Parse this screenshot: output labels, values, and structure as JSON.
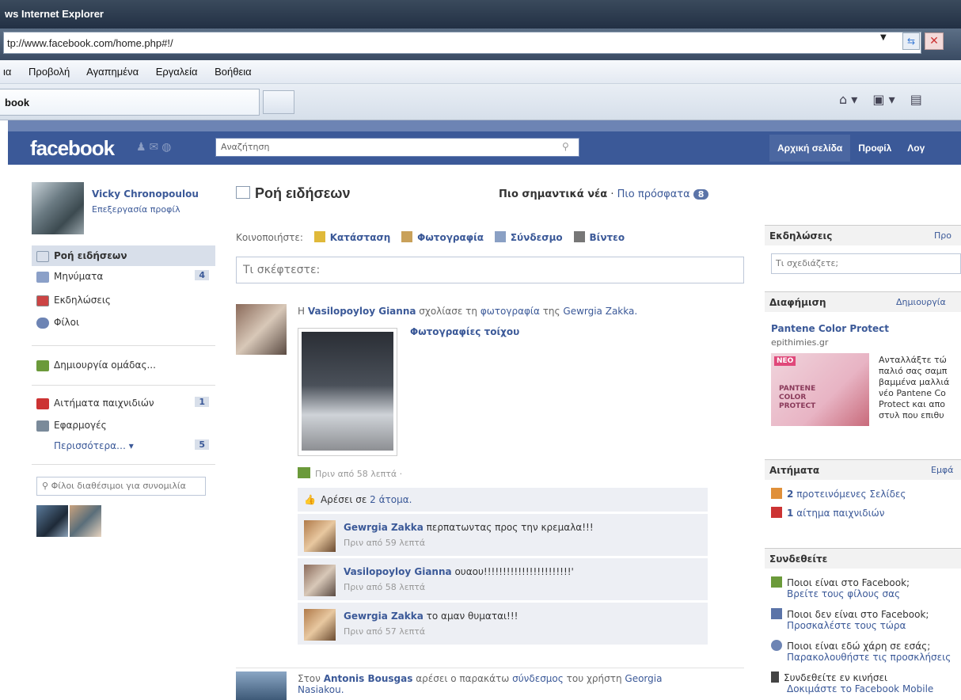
{
  "window": {
    "title": "ws Internet Explorer",
    "url": "tp://www.facebook.com/home.php#!/",
    "tab": "book"
  },
  "menu": [
    "ια",
    "Προβολή",
    "Αγαπημένα",
    "Εργαλεία",
    "Βοήθεια"
  ],
  "fb": {
    "logo": "facebook",
    "search_placeholder": "Αναζήτηση",
    "topnav": [
      "Αρχική σελίδα",
      "Προφίλ",
      "Λογ"
    ]
  },
  "profile": {
    "name": "Vicky Chronopoulou",
    "edit": "Επεξεργασία προφίλ"
  },
  "left_nav": [
    {
      "label": "Ροή ειδήσεων",
      "count": ""
    },
    {
      "label": "Μηνύματα",
      "count": "4"
    },
    {
      "label": "Εκδηλώσεις",
      "count": ""
    },
    {
      "label": "Φίλοι",
      "count": ""
    },
    {
      "label": "Δημιουργία ομάδας...",
      "count": ""
    },
    {
      "label": "Αιτήματα παιχνιδιών",
      "count": "1"
    },
    {
      "label": "Εφαρμογές",
      "count": ""
    },
    {
      "label": "Περισσότερα… ▾",
      "count": "5"
    }
  ],
  "chat_placeholder": "Φίλοι διαθέσιμοι για συνομιλία",
  "feed": {
    "title": "Ροή ειδήσεων",
    "top": "Πιο σημαντικά νέα",
    "recent": "Πιο πρόσφατα",
    "recent_count": "8",
    "share_label": "Κοινοποιήστε:",
    "share_opts": [
      "Κατάσταση",
      "Φωτογραφία",
      "Σύνδεσμο",
      "Βίντεο"
    ],
    "status_placeholder": "Τι σκέφτεστε:"
  },
  "story1": {
    "prefix": "Η",
    "actor": "Vasilopoyloy Gianna",
    "mid": "σχολίασε τη",
    "link": "φωτογραφία",
    "mid2": "της",
    "target": "Gewrgia Zakka.",
    "album": "Φωτογραφίες τοίχου",
    "time": "Πριν από 58 λεπτά ·",
    "likes_pre": "Αρέσει σε",
    "likes_link": "2 άτομα.",
    "comments": [
      {
        "author": "Gewrgia Zakka",
        "text": "περπατωντας προς την κρεμαλα!!!",
        "time": "Πριν από 59 λεπτά"
      },
      {
        "author": "Vasilopoyloy Gianna",
        "text": "ουαου!!!!!!!!!!!!!!!!!!!!!!!'",
        "time": "Πριν από 58 λεπτά"
      },
      {
        "author": "Gewrgia Zakka",
        "text": "το αμαν θυμαται!!!",
        "time": "Πριν από 57 λεπτά"
      }
    ]
  },
  "story2": {
    "prefix": "Στον",
    "actor": "Antonis Bousgas",
    "mid": "αρέσει ο παρακάτω",
    "link": "σύνδεσμος",
    "mid2": "του χρήστη",
    "target": "Georgia",
    "line2": "Nasiakou."
  },
  "right": {
    "events_title": "Εκδηλώσεις",
    "events_link": "Προ",
    "events_placeholder": "Τι σχεδιάζετε;",
    "ad_title": "Διαφήμιση",
    "ad_link": "Δημιουργία",
    "ad_name": "Pantene Color Protect",
    "ad_domain": "epithimies.gr",
    "ad_badge": "ΝΕΟ",
    "ad_img_text": "PANTENE COLOR PROTECT",
    "ad_text": [
      "Ανταλλάξτε τώ",
      "παλιό σας σαμπ",
      "βαμμένα μαλλιά",
      "νέο Pantene Co",
      "Protect και απο",
      "στυλ που επιθυ"
    ],
    "req_title": "Αιτήματα",
    "req_link": "Εμφά",
    "req_items": [
      {
        "num": "2",
        "text": "προτεινόμενες Σελίδες"
      },
      {
        "num": "1",
        "text": "αίτημα παιχνιδιών"
      }
    ],
    "connect_title": "Συνδεθείτε",
    "connect_items": [
      {
        "line": "Ποιοι είναι στο Facebook;",
        "sub": "Βρείτε τους φίλους σας"
      },
      {
        "line": "Ποιοι δεν είναι στο Facebook;",
        "sub": "Προσκαλέστε τους τώρα"
      },
      {
        "line": "Ποιοι είναι εδώ χάρη σε εσάς;",
        "sub": "Παρακολουθήστε τις προσκλήσεις"
      },
      {
        "line": "Συνδεθείτε εν κινήσει",
        "sub": "Δοκιμάστε το Facebook Mobile"
      }
    ]
  },
  "colors": {
    "fb_blue": "#3b5998",
    "fb_light": "#d8dfea"
  },
  "icons": [
    "home-icon",
    "rss-icon",
    "print-icon",
    "refresh-icon",
    "stop-icon",
    "search-icon"
  ]
}
